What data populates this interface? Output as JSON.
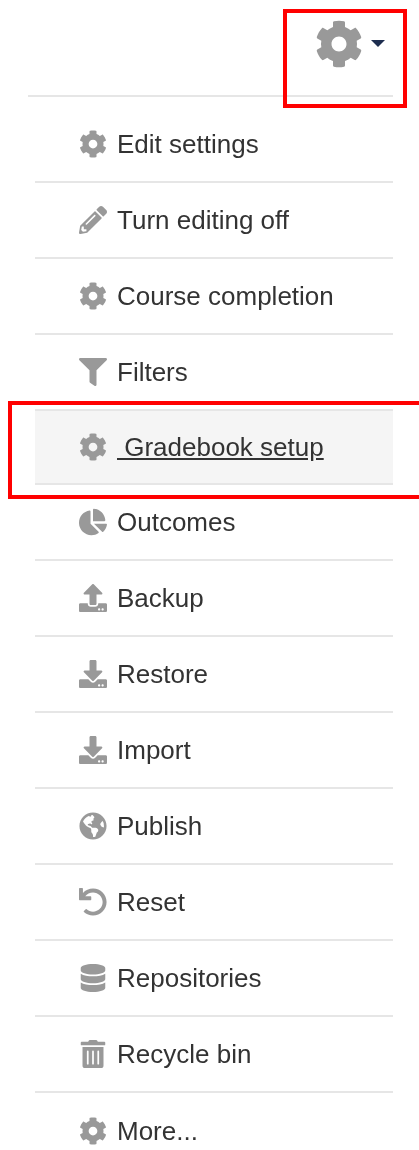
{
  "settings_button": {
    "annotated": true
  },
  "menu": {
    "items": [
      {
        "label": "Edit settings",
        "selected": false,
        "annotated": false
      },
      {
        "label": "Turn editing off",
        "selected": false,
        "annotated": false
      },
      {
        "label": "Course completion",
        "selected": false,
        "annotated": false
      },
      {
        "label": "Filters",
        "selected": false,
        "annotated": false
      },
      {
        "label": " Gradebook setup",
        "selected": true,
        "annotated": true
      },
      {
        "label": "Outcomes",
        "selected": false,
        "annotated": false
      },
      {
        "label": "Backup",
        "selected": false,
        "annotated": false
      },
      {
        "label": "Restore",
        "selected": false,
        "annotated": false
      },
      {
        "label": "Import",
        "selected": false,
        "annotated": false
      },
      {
        "label": "Publish",
        "selected": false,
        "annotated": false
      },
      {
        "label": "Reset",
        "selected": false,
        "annotated": false
      },
      {
        "label": "Repositories",
        "selected": false,
        "annotated": false
      },
      {
        "label": "Recycle bin",
        "selected": false,
        "annotated": false
      },
      {
        "label": "More...",
        "selected": false,
        "annotated": false
      }
    ]
  }
}
